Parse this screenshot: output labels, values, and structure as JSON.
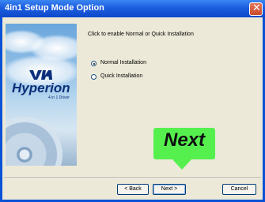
{
  "window": {
    "title": "4in1 Setup Mode Option"
  },
  "side_image": {
    "brand_mark": "VIA",
    "brand": "Hyperion",
    "brand_sub": "4 in 1 Driver"
  },
  "instruction": "Click to enable Normal or Quick Installation",
  "options": [
    {
      "label": "Normal Installation",
      "selected": true
    },
    {
      "label": "Quick Installation",
      "selected": false
    }
  ],
  "callout": {
    "text": "Next",
    "color": "#56f04e"
  },
  "buttons": {
    "back": "< Back",
    "next": "Next >",
    "cancel": "Cancel"
  },
  "colors": {
    "titlebar": "#1c5de0",
    "client": "#ece9d8",
    "close": "#c84a2a"
  }
}
